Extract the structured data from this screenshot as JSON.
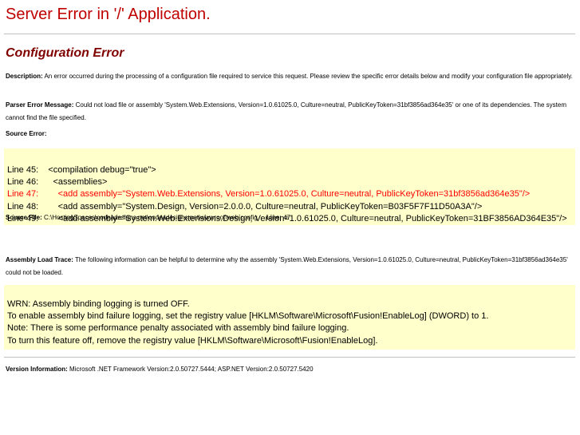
{
  "header": {
    "title": "Server Error in '/' Application.",
    "subtitle": "Configuration Error"
  },
  "description": {
    "label": "Description:",
    "text": " An error occurred during the processing of a configuration file required to service this request. Please review the specific error details below and modify your configuration file appropriately."
  },
  "parser_error": {
    "label": "Parser Error Message:",
    "text": " Could not load file or assembly 'System.Web.Extensions, Version=1.0.61025.0, Culture=neutral, PublicKeyToken=31bf3856ad364e35' or one of its dependencies. The system cannot find the file specified."
  },
  "source_error": {
    "label": "Source Error:",
    "lines": [
      {
        "num": "Line 45:",
        "code": "    <compilation debug=\"true\">",
        "highlight": false
      },
      {
        "num": "Line 46:",
        "code": "      <assemblies>",
        "highlight": false
      },
      {
        "num": "Line 47:",
        "code": "        <add assembly=\"System.Web.Extensions, Version=1.0.61025.0, Culture=neutral, PublicKeyToken=31bf3856ad364e35\"/>",
        "highlight": true
      },
      {
        "num": "Line 48:",
        "code": "        <add assembly=\"System.Design, Version=2.0.0.0, Culture=neutral, PublicKeyToken=B03F5F7F11D50A3A\"/>",
        "highlight": false
      },
      {
        "num": "Line 49:",
        "code": "        <add assembly=\"System.Web.Extensions.Design, Version=1.0.61025.0, Culture=neutral, PublicKeyToken=31BF3856AD364E35\"/>",
        "highlight": false
      }
    ]
  },
  "source_file": {
    "label": "Source File:",
    "path": " C:\\HostingSpaces\\codeadesigns.net\\codeadesigns.net\\wwwroot\\web.config ",
    "line_label": "Line:",
    "line_value": " 47"
  },
  "assembly_trace": {
    "label": "Assembly Load Trace:",
    "text": " The following information can be helpful to determine why the assembly 'System.Web.Extensions, Version=1.0.61025.0, Culture=neutral, PublicKeyToken=31bf3856ad364e35' could not be loaded."
  },
  "trace_box": {
    "lines": [
      "WRN: Assembly binding logging is turned OFF.",
      "To enable assembly bind failure logging, set the registry value [HKLM\\Software\\Microsoft\\Fusion!EnableLog] (DWORD) to 1.",
      "Note: There is some performance penalty associated with assembly bind failure logging.",
      "To turn this feature off, remove the registry value [HKLM\\Software\\Microsoft\\Fusion!EnableLog]."
    ]
  },
  "version_info": {
    "label": "Version Information:",
    "text": " Microsoft .NET Framework Version:2.0.50727.5444; ASP.NET Version:2.0.50727.5420"
  },
  "colors": {
    "title": "#c00000",
    "subtitle": "#800000",
    "code_bg": "#ffffcc",
    "highlight": "#ff0000"
  }
}
